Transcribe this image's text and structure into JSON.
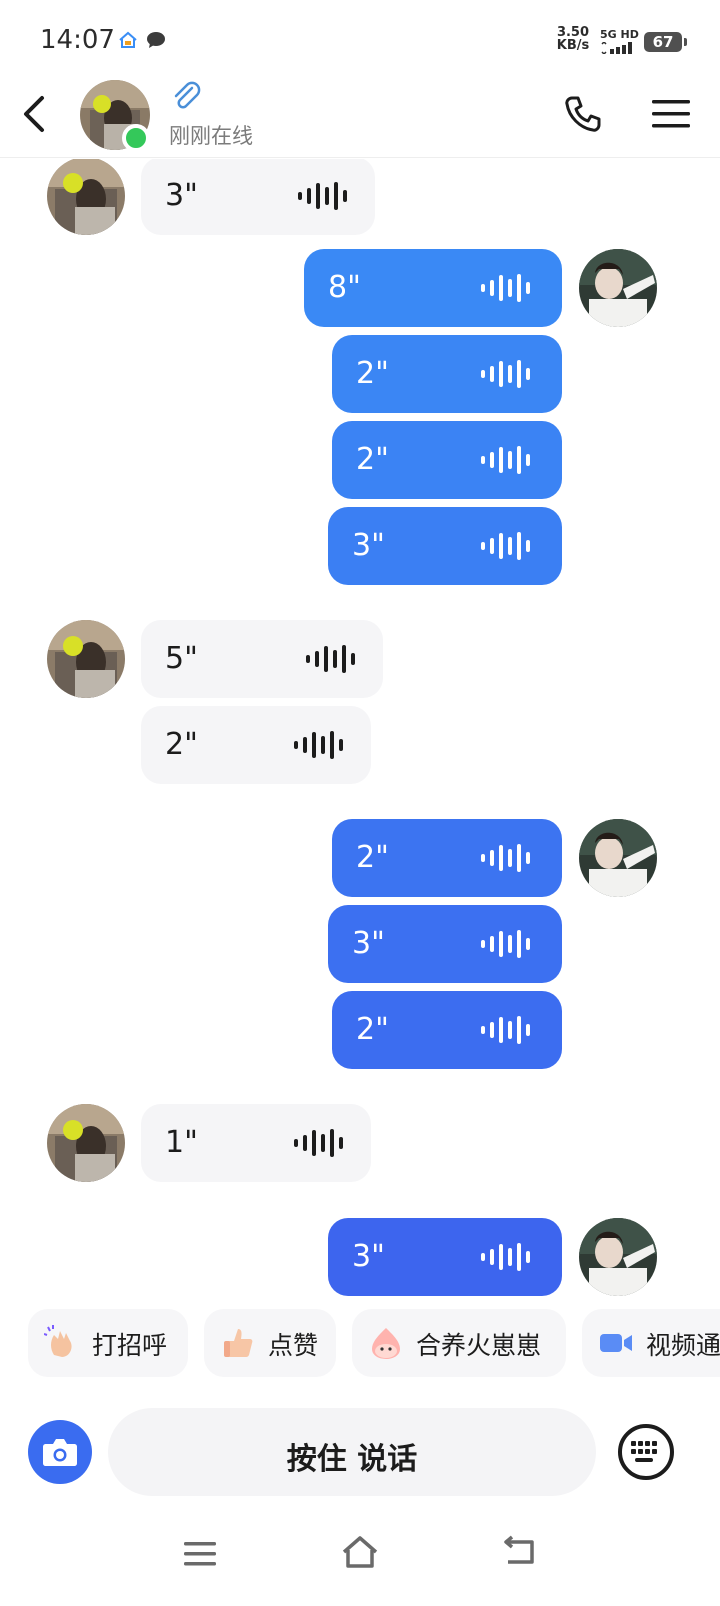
{
  "status_bar": {
    "time": "14:07",
    "net_speed_value": "3.50",
    "net_speed_unit": "KB/s",
    "network": "5G HD",
    "battery": "67"
  },
  "header": {
    "status": "刚刚在线",
    "online": true
  },
  "messages": [
    {
      "side": "in",
      "duration": "3\""
    },
    {
      "side": "out",
      "duration": "8\""
    },
    {
      "side": "out",
      "duration": "2\""
    },
    {
      "side": "out",
      "duration": "2\""
    },
    {
      "side": "out",
      "duration": "3\""
    },
    {
      "side": "in",
      "duration": "5\""
    },
    {
      "side": "in",
      "duration": "2\""
    },
    {
      "side": "out",
      "duration": "2\""
    },
    {
      "side": "out",
      "duration": "3\""
    },
    {
      "side": "out",
      "duration": "2\""
    },
    {
      "side": "in",
      "duration": "1\""
    },
    {
      "side": "out",
      "duration": "3\""
    }
  ],
  "quick_actions": [
    {
      "icon": "wave-hand-icon",
      "label": "打招呼"
    },
    {
      "icon": "thumbs-up-icon",
      "label": "点赞"
    },
    {
      "icon": "fire-sprite-icon",
      "label": "合养火崽崽"
    },
    {
      "icon": "video-camera-icon",
      "label": "视频通话"
    }
  ],
  "input_bar": {
    "talk_label": "按住 说话"
  },
  "colors": {
    "outgoing_gradient_top": "#3a8ef6",
    "outgoing_gradient_bottom": "#3d63ee",
    "incoming_bubble": "#f5f5f7",
    "online_dot": "#34c85a",
    "accent": "#3a6cf0"
  }
}
